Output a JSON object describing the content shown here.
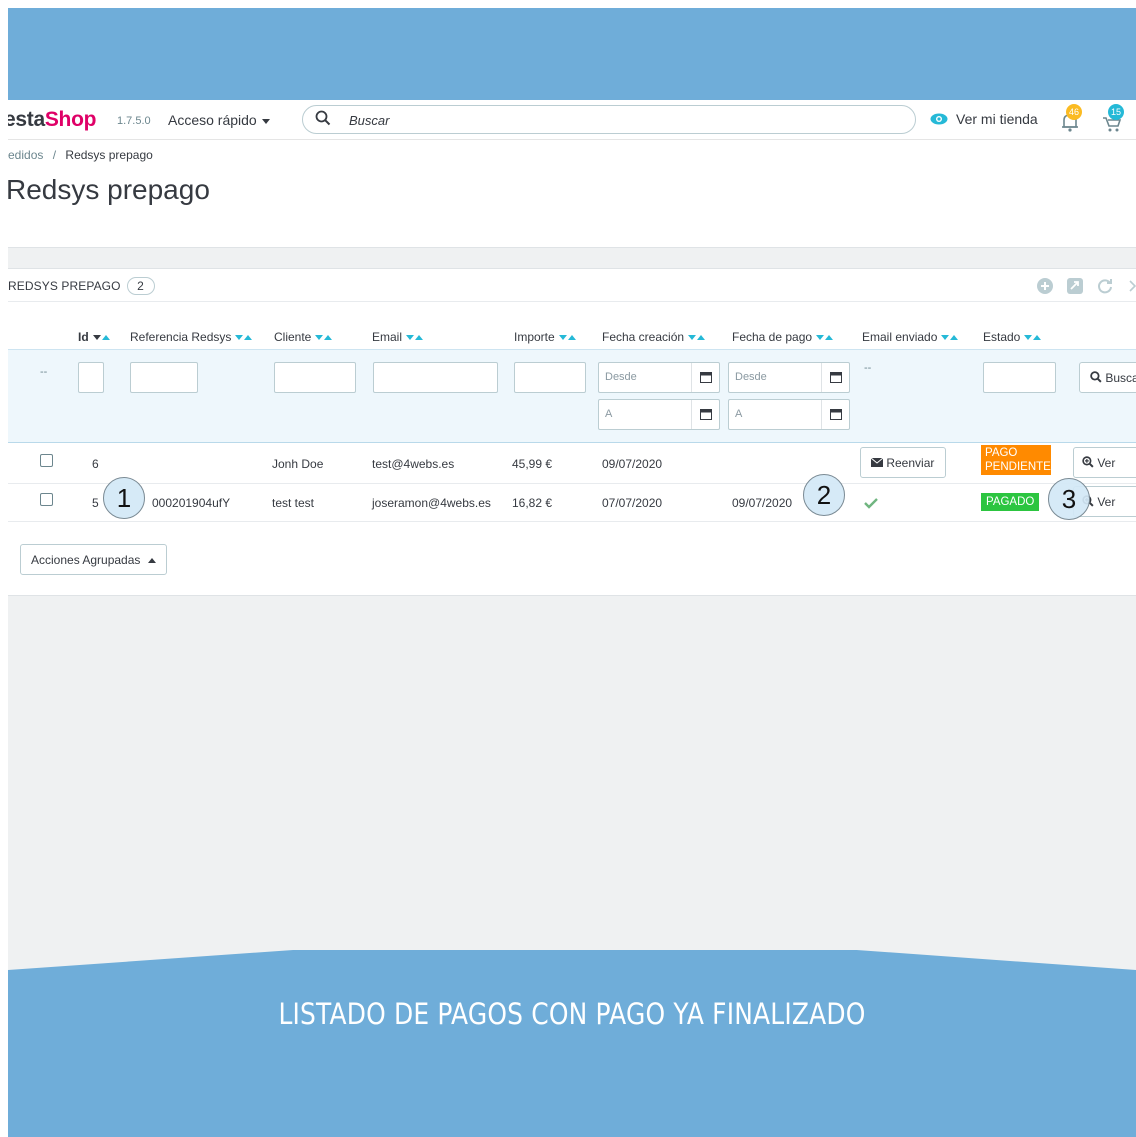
{
  "header": {
    "logo_prefix": "esta",
    "logo_suffix": "Shop",
    "version": "1.7.5.0",
    "quick_access": "Acceso rápido",
    "search_placeholder": "Buscar",
    "view_shop": "Ver mi tienda",
    "notifications": [
      {
        "icon": "bell-icon",
        "count": "46",
        "color": "#fbbb22"
      },
      {
        "icon": "cart-icon",
        "count": "15",
        "color": "#25b9d7"
      }
    ]
  },
  "breadcrumb": {
    "parent": "edidos",
    "separator": "/",
    "current": "Redsys prepago"
  },
  "page_title": "Redsys prepago",
  "panel": {
    "title": "REDSYS PREPAGO",
    "count": "2",
    "toolbar_icons": [
      "add-icon",
      "export-icon",
      "refresh-icon",
      "more-icon"
    ]
  },
  "table": {
    "headers": {
      "id": "Id",
      "referencia": "Referencia Redsys",
      "cliente": "Cliente",
      "email": "Email",
      "importe": "Importe",
      "fecha_creacion": "Fecha creación",
      "fecha_pago": "Fecha de pago",
      "email_enviado": "Email enviado",
      "estado": "Estado"
    },
    "filters": {
      "checkbox_dash": "--",
      "email_sent_dash": "--",
      "from_placeholder": "Desde",
      "to_placeholder": "A",
      "search_button": "Buscar"
    },
    "rows": [
      {
        "id": "6",
        "referencia": "",
        "cliente": "Jonh Doe",
        "email": "test@4webs.es",
        "importe": "45,99 €",
        "fecha_creacion": "09/07/2020",
        "fecha_pago": "",
        "email_action": "Reenviar",
        "estado_line1": "PAGO",
        "estado_line2": "PENDIENTE",
        "estado_color": "#ff8a00",
        "view_button": "Ver"
      },
      {
        "id": "5",
        "referencia": "000201904ufY",
        "cliente": "test test",
        "email": "joseramon@4webs.es",
        "importe": "16,82 €",
        "fecha_creacion": "07/07/2020",
        "fecha_pago": "09/07/2020",
        "email_action": "",
        "estado_line1": "PAGADO",
        "estado_line2": "",
        "estado_color": "#2cc540",
        "view_button": "Ver"
      }
    ]
  },
  "bulk_actions": "Acciones Agrupadas",
  "markers": [
    "1",
    "2",
    "3"
  ],
  "caption": "LISTADO DE PAGOS CON PAGO YA FINALIZADO",
  "colors": {
    "accent": "#25b9d7",
    "frame": "#6fadd9",
    "brand": "#df0067"
  }
}
